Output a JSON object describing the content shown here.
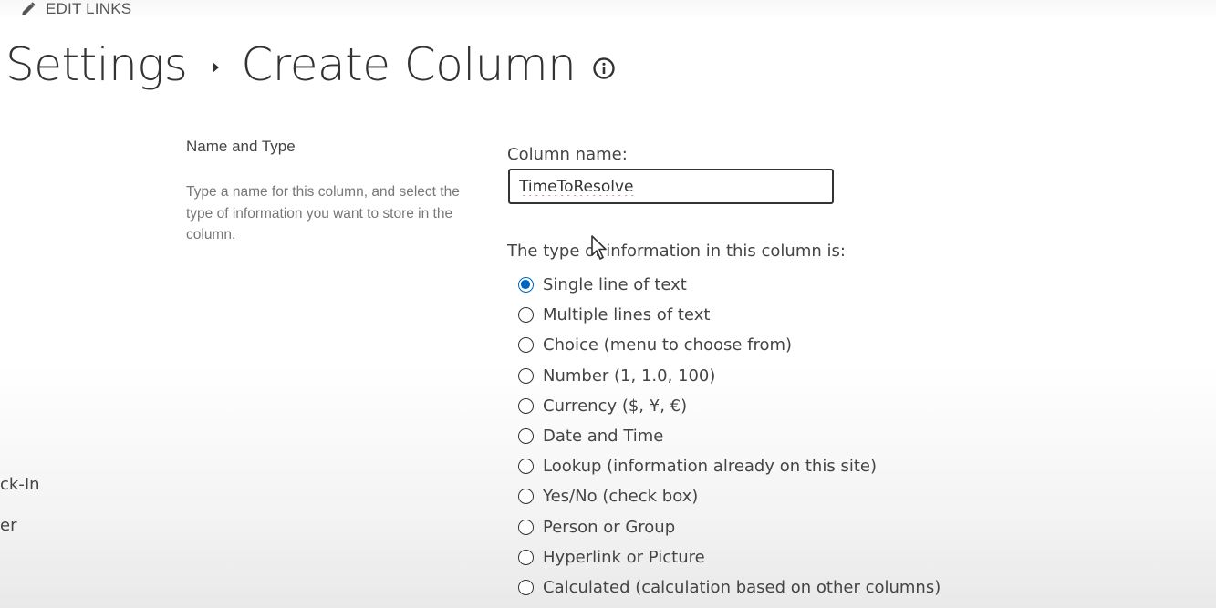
{
  "toolbar": {
    "edit_links_label": "EDIT LINKS",
    "edit_icon": "pencil-icon"
  },
  "breadcrumb": {
    "parent": "Settings",
    "current": "Create Column",
    "info_icon": "info-icon"
  },
  "left_nav": {
    "items": [
      "ck-In",
      "er"
    ]
  },
  "section": {
    "title": "Name and Type",
    "description": "Type a name for this column, and select the type of information you want to store in the column."
  },
  "column_name": {
    "label": "Column name:",
    "value": "TimeToResolve"
  },
  "column_type": {
    "label": "The type of information in this column is:",
    "selected": "Single line of text",
    "options": [
      "Single line of text",
      "Multiple lines of text",
      "Choice (menu to choose from)",
      "Number (1, 1.0, 100)",
      "Currency ($, ¥, €)",
      "Date and Time",
      "Lookup (information already on this site)",
      "Yes/No (check box)",
      "Person or Group",
      "Hyperlink or Picture",
      "Calculated (calculation based on other columns)"
    ]
  },
  "colors": {
    "accent": "#0067c0",
    "text": "#333333",
    "muted": "#777777",
    "spellcheck": "#d9534f"
  }
}
